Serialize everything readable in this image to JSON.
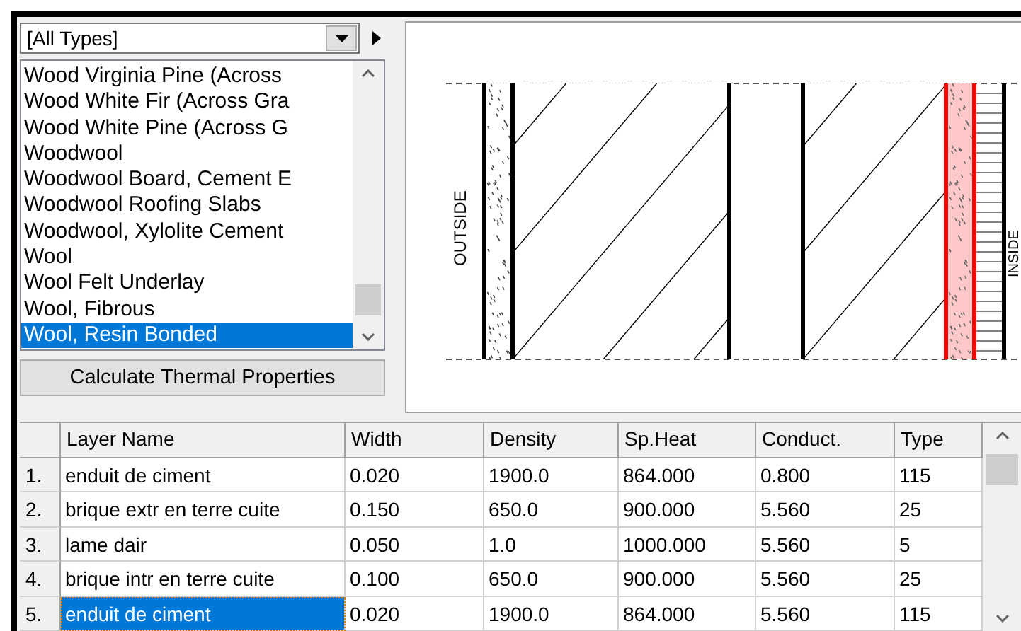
{
  "type_filter": {
    "value": "[All Types]"
  },
  "materials": [
    {
      "label": "Wood Virginia Pine (Across",
      "selected": false
    },
    {
      "label": "Wood White Fir (Across Gra",
      "selected": false
    },
    {
      "label": "Wood White Pine (Across G",
      "selected": false
    },
    {
      "label": "Woodwool",
      "selected": false
    },
    {
      "label": "Woodwool Board, Cement E",
      "selected": false
    },
    {
      "label": "Woodwool Roofing Slabs",
      "selected": false
    },
    {
      "label": "Woodwool, Xylolite Cement",
      "selected": false
    },
    {
      "label": "Wool",
      "selected": false
    },
    {
      "label": "Wool Felt Underlay",
      "selected": false
    },
    {
      "label": "Wool, Fibrous",
      "selected": false
    },
    {
      "label": "Wool, Resin Bonded",
      "selected": true
    }
  ],
  "calculate_button": "Calculate Thermal Properties",
  "diagram": {
    "outside_label": "OUTSIDE",
    "inside_label": "INSIDE"
  },
  "table": {
    "columns": [
      "Layer Name",
      "Width",
      "Density",
      "Sp.Heat",
      "Conduct.",
      "Type"
    ],
    "rows": [
      {
        "index": "1.",
        "cells": [
          "enduit de ciment",
          "0.020",
          "1900.0",
          "864.000",
          "0.800",
          "115"
        ],
        "selected": false
      },
      {
        "index": "2.",
        "cells": [
          "brique extr en terre cuite",
          "0.150",
          "650.0",
          "900.000",
          "5.560",
          "25"
        ],
        "selected": false
      },
      {
        "index": "3.",
        "cells": [
          "lame dair",
          "0.050",
          "1.0",
          "1000.000",
          "5.560",
          "5"
        ],
        "selected": false
      },
      {
        "index": "4.",
        "cells": [
          "brique intr en terre cuite",
          "0.100",
          "650.0",
          "900.000",
          "5.560",
          "25"
        ],
        "selected": false
      },
      {
        "index": "5.",
        "cells": [
          "enduit de ciment",
          "0.020",
          "1900.0",
          "864.000",
          "5.560",
          "115"
        ],
        "selected": true
      }
    ]
  }
}
